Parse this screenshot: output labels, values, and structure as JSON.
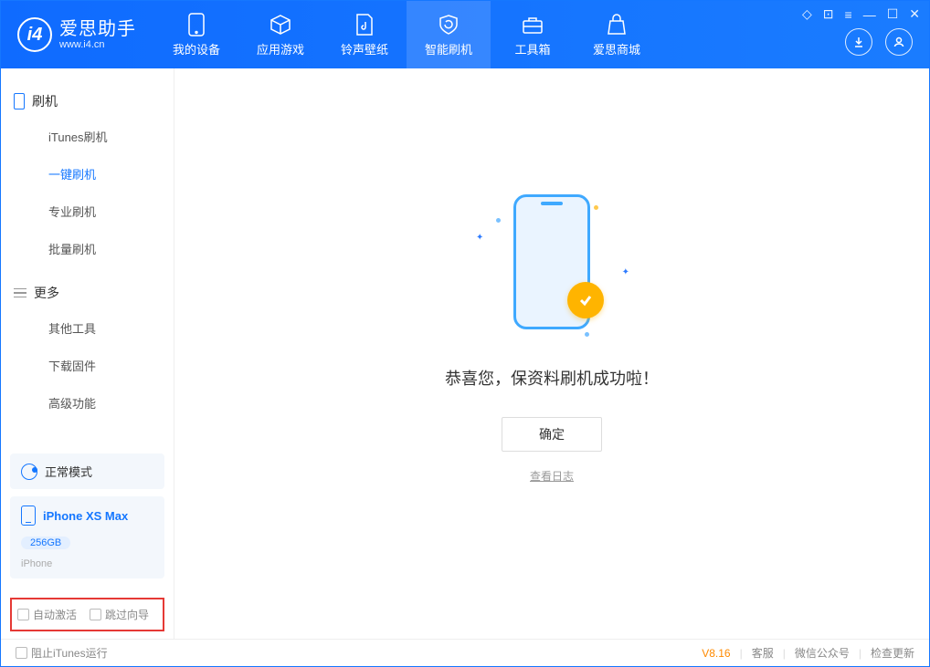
{
  "app": {
    "title": "爱思助手",
    "subtitle": "www.i4.cn",
    "logo_letter": "i4"
  },
  "nav": {
    "tabs": [
      {
        "label": "我的设备"
      },
      {
        "label": "应用游戏"
      },
      {
        "label": "铃声壁纸"
      },
      {
        "label": "智能刷机"
      },
      {
        "label": "工具箱"
      },
      {
        "label": "爱思商城"
      }
    ]
  },
  "sidebar": {
    "section_flash": "刷机",
    "items_flash": [
      "iTunes刷机",
      "一键刷机",
      "专业刷机",
      "批量刷机"
    ],
    "section_more": "更多",
    "items_more": [
      "其他工具",
      "下载固件",
      "高级功能"
    ],
    "mode_card": "正常模式",
    "device": {
      "name": "iPhone XS Max",
      "capacity": "256GB",
      "type": "iPhone"
    },
    "cb1": "自动激活",
    "cb2": "跳过向导"
  },
  "main": {
    "success": "恭喜您，保资料刷机成功啦！",
    "ok": "确定",
    "log": "查看日志"
  },
  "status": {
    "block_itunes": "阻止iTunes运行",
    "version": "V8.16",
    "links": [
      "客服",
      "微信公众号",
      "检查更新"
    ]
  }
}
